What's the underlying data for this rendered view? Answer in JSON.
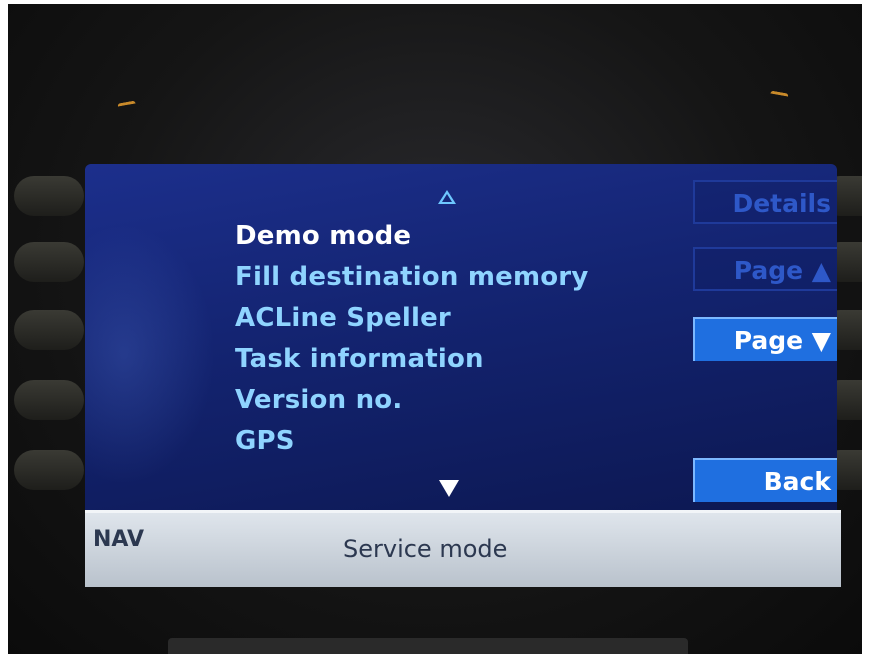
{
  "menu": {
    "items": [
      {
        "label": "Demo mode",
        "selected": true
      },
      {
        "label": "Fill destination memory",
        "selected": false
      },
      {
        "label": "ACLine Speller",
        "selected": false
      },
      {
        "label": "Task information",
        "selected": false
      },
      {
        "label": "Version no.",
        "selected": false
      },
      {
        "label": "GPS",
        "selected": false
      }
    ]
  },
  "softkeys": {
    "details": {
      "label": "Details",
      "enabled": false
    },
    "page_up": {
      "label": "Page ▲",
      "enabled": false
    },
    "page_down": {
      "label": "Page ▼",
      "enabled": true
    },
    "back": {
      "label": "Back",
      "enabled": true
    }
  },
  "statusbar": {
    "source": "NAV",
    "title": "Service mode"
  },
  "colors": {
    "screen_bg": "#13236f",
    "menu_text": "#8fd4ff",
    "menu_selected": "#ffffff",
    "softkey_active": "#1f6fe0",
    "softkey_inactive_text": "#2e58c8",
    "statusbar_bg": "#cfd6de"
  },
  "icons": {
    "scroll_up": "triangle-up-outline-icon",
    "scroll_down": "triangle-down-filled-icon"
  }
}
